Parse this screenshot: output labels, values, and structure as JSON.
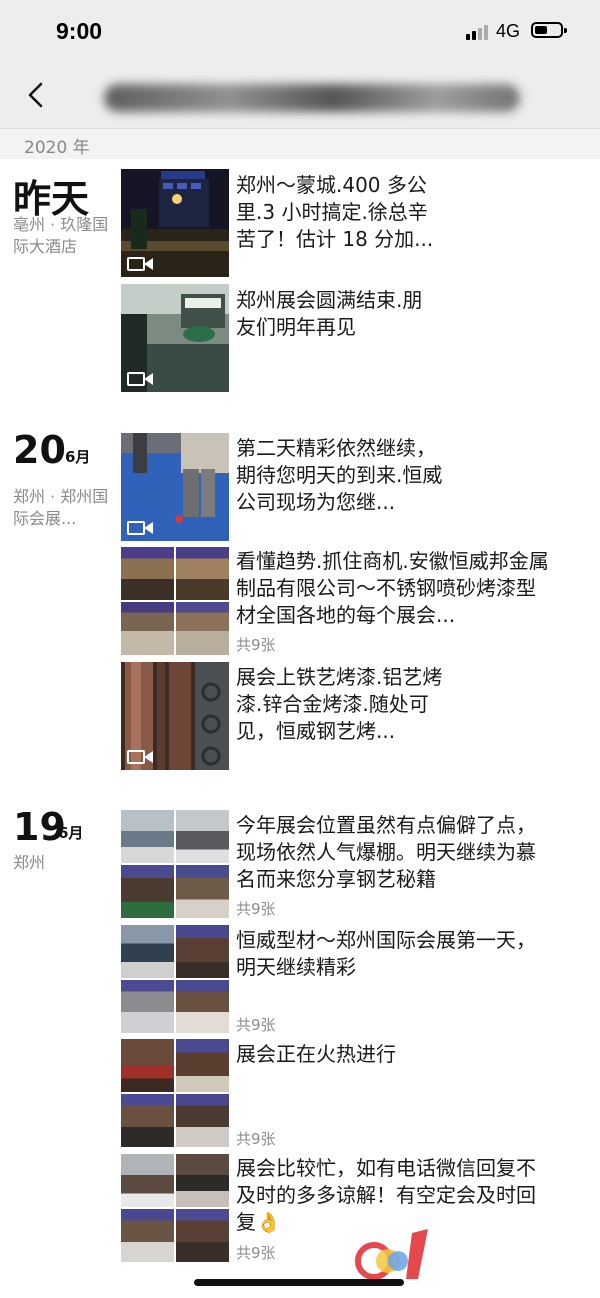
{
  "status_bar": {
    "time": "9:00",
    "network": "4G"
  },
  "nav": {
    "back_icon": "chevron-left-icon",
    "title": ""
  },
  "year_label": "2020 年",
  "days": [
    {
      "day": "昨天",
      "month": "",
      "location": "亳州 · 玖隆国际大酒店",
      "posts": [
        {
          "type": "video",
          "text": "郑州～蒙城.400 多公里.3 小时搞定.徐总辛苦了！估计 18 分加...",
          "count": ""
        },
        {
          "type": "video",
          "text": "郑州展会圆满结束.朋友们明年再见",
          "count": ""
        }
      ]
    },
    {
      "day": "20",
      "month": "6月",
      "location": "郑州 · 郑州国际会展...",
      "posts": [
        {
          "type": "video",
          "text": "第二天精彩依然继续，期待您明天的到来.恒威公司现场为您继...",
          "count": ""
        },
        {
          "type": "images",
          "text": "看懂趋势.抓住商机.安徽恒威邦金属制品有限公司～不锈钢喷砂烤漆型材全国各地的每个展会...",
          "count": "共9张"
        },
        {
          "type": "video",
          "text": "展会上铁艺烤漆.铝艺烤漆.锌合金烤漆.随处可见，恒威钢艺烤...",
          "count": ""
        }
      ]
    },
    {
      "day": "19",
      "month": "6月",
      "location": "郑州",
      "posts": [
        {
          "type": "images",
          "text": "今年展会位置虽然有点偏僻了点，现场依然人气爆棚。明天继续为慕名而来您分享钢艺秘籍",
          "count": "共9张"
        },
        {
          "type": "images",
          "text": "恒威型材～郑州国际会展第一天，明天继续精彩",
          "count": "共9张"
        },
        {
          "type": "images",
          "text": "展会正在火热进行",
          "count": "共9张"
        },
        {
          "type": "images",
          "text": "展会比较忙，如有电话微信回复不及时的多多谅解！有空定会及时回复👌",
          "count": "共9张"
        }
      ]
    }
  ],
  "colors": {
    "background": "#ffffff",
    "header": "#ededed",
    "secondary_text": "#8a8a8a"
  }
}
